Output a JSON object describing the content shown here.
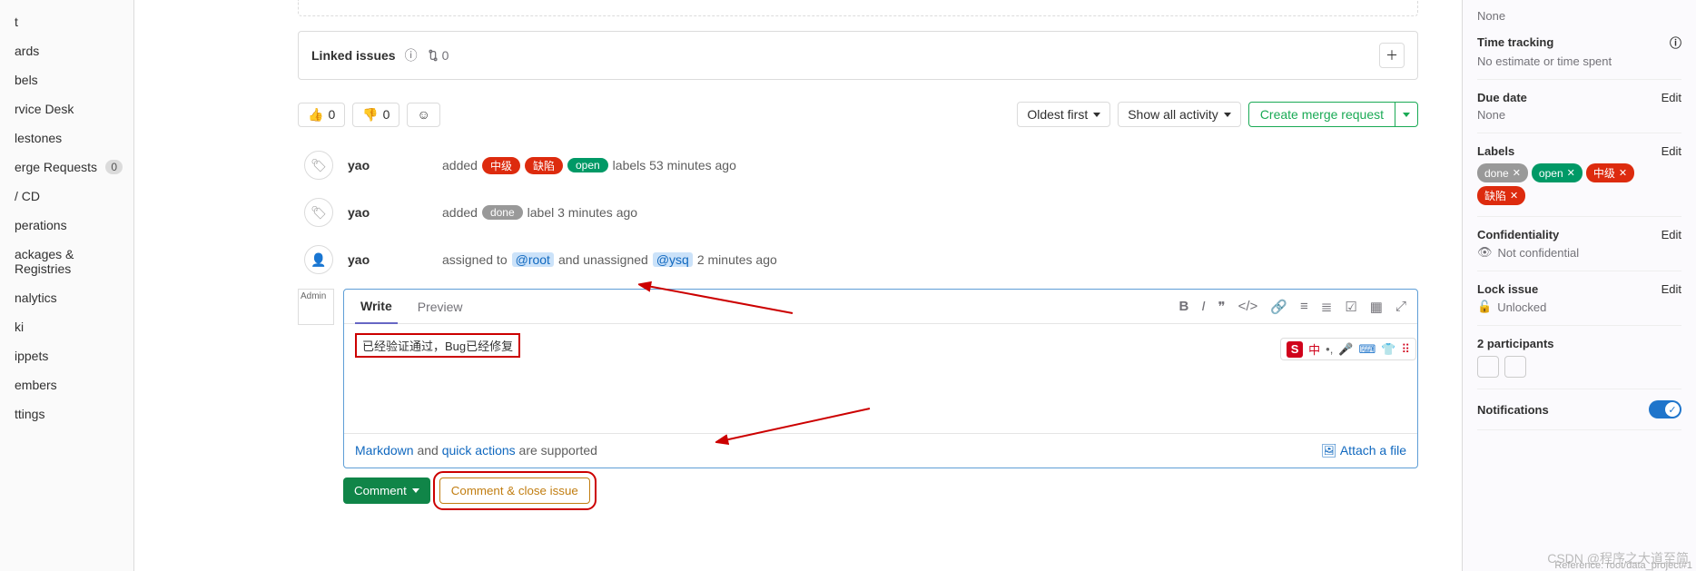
{
  "sidebar": {
    "items": [
      {
        "label": "t"
      },
      {
        "label": "ards"
      },
      {
        "label": "bels"
      },
      {
        "label": "rvice Desk"
      },
      {
        "label": "lestones"
      },
      {
        "label": "erge Requests",
        "count": "0"
      },
      {
        "label": "/ CD"
      },
      {
        "label": "perations"
      },
      {
        "label": "ackages & Registries"
      },
      {
        "label": "nalytics"
      },
      {
        "label": "ki"
      },
      {
        "label": "ippets"
      },
      {
        "label": "embers"
      },
      {
        "label": "ttings"
      }
    ]
  },
  "linked": {
    "title": "Linked issues",
    "count": "0"
  },
  "reactions": {
    "thumbs_up": "0",
    "thumbs_down": "0"
  },
  "filters": {
    "sort": "Oldest first",
    "show": "Show all activity",
    "create_mr": "Create merge request"
  },
  "activity": [
    {
      "user": "yao",
      "prefix": "added",
      "labels": [
        {
          "text": "中级",
          "cls": "label-red"
        },
        {
          "text": "缺陷",
          "cls": "label-red"
        },
        {
          "text": "open",
          "cls": "label-green"
        }
      ],
      "suffix": "labels 53 minutes ago",
      "icon": "tag"
    },
    {
      "user": "yao",
      "prefix": "added",
      "labels": [
        {
          "text": "done",
          "cls": "label-gray"
        }
      ],
      "suffix": "label 3 minutes ago",
      "icon": "tag"
    },
    {
      "user": "yao",
      "assign_prefix": "assigned to",
      "assign_user1": "@root",
      "assign_mid": "and unassigned",
      "assign_user2": "@ysq",
      "assign_suffix": "2 minutes ago",
      "icon": "user"
    }
  ],
  "comment": {
    "avatar_alt": "Admin",
    "tab_write": "Write",
    "tab_preview": "Preview",
    "text": "已经验证通过，Bug已经修复",
    "footer_markdown": "Markdown",
    "footer_and": " and ",
    "footer_quick": "quick actions",
    "footer_supported": " are supported",
    "attach": "Attach a file",
    "btn_comment": "Comment",
    "btn_close": "Comment & close issue"
  },
  "right": {
    "none1": "None",
    "time_tracking": "Time tracking",
    "time_value": "No estimate or time spent",
    "due_date": "Due date",
    "due_value": "None",
    "labels_title": "Labels",
    "labels": [
      {
        "text": "done",
        "cls": "label-gray"
      },
      {
        "text": "open",
        "cls": "label-green"
      },
      {
        "text": "中级",
        "cls": "label-red"
      },
      {
        "text": "缺陷",
        "cls": "label-red"
      }
    ],
    "confidentiality": "Confidentiality",
    "conf_value": "Not confidential",
    "lock": "Lock issue",
    "lock_value": "Unlocked",
    "participants": "2 participants",
    "notifications": "Notifications",
    "edit": "Edit",
    "reference": "Reference: root/data_project#1"
  },
  "watermark": "CSDN @程序之大道至简",
  "ime": {
    "zh": "中"
  }
}
